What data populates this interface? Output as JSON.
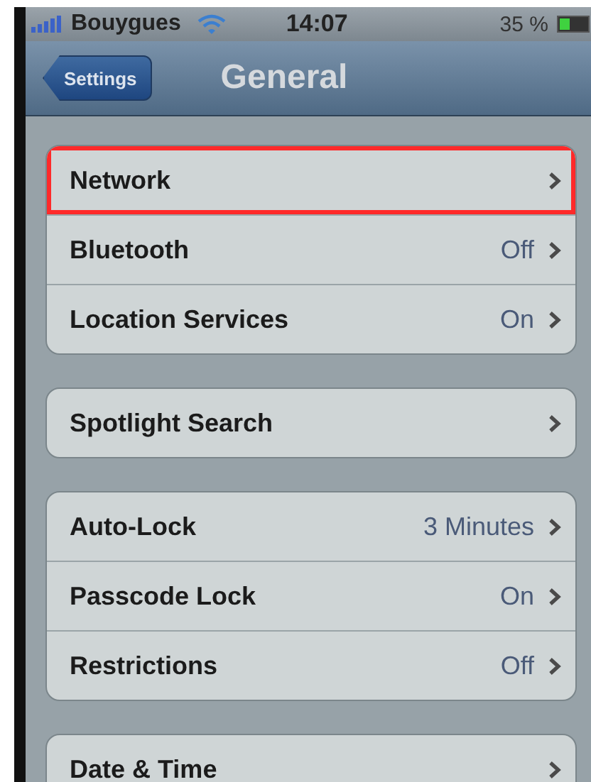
{
  "status_bar": {
    "carrier": "Bouygues",
    "time": "14:07",
    "battery": "35 %"
  },
  "nav_bar": {
    "back_button": "Settings",
    "title": "General"
  },
  "groups": [
    {
      "rows": [
        {
          "label": "Network",
          "value": "",
          "highlighted": true
        },
        {
          "label": "Bluetooth",
          "value": "Off",
          "highlighted": false
        },
        {
          "label": "Location Services",
          "value": "On",
          "highlighted": false
        }
      ]
    },
    {
      "rows": [
        {
          "label": "Spotlight Search",
          "value": "",
          "highlighted": false
        }
      ]
    },
    {
      "rows": [
        {
          "label": "Auto-Lock",
          "value": "3 Minutes",
          "highlighted": false
        },
        {
          "label": "Passcode Lock",
          "value": "On",
          "highlighted": false
        },
        {
          "label": "Restrictions",
          "value": "Off",
          "highlighted": false
        }
      ]
    },
    {
      "rows": [
        {
          "label": "Date & Time",
          "value": "",
          "highlighted": false
        }
      ]
    }
  ]
}
